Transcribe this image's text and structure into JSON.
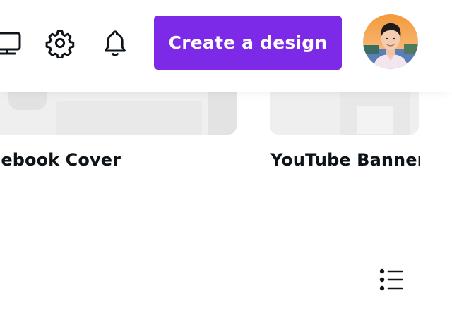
{
  "header": {
    "desktop_icon": "desktop-monitor-icon",
    "settings_icon": "gear-icon",
    "notifications_icon": "bell-icon",
    "create_button_label": "Create a design",
    "accent_color": "#7d2ae8",
    "avatar_icon": "user-avatar"
  },
  "templates": [
    {
      "label": "cebook Cover"
    },
    {
      "label": "YouTube Banner"
    }
  ],
  "view_toggle": {
    "icon": "list-view-icon"
  }
}
